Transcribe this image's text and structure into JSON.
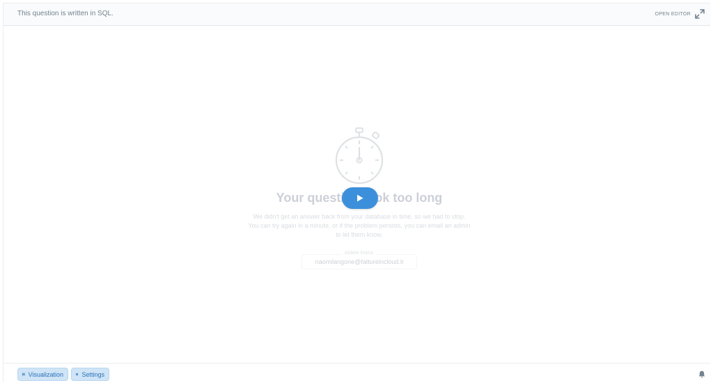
{
  "header": {
    "note": "This question is written in SQL.",
    "open_editor_label": "OPEN EDITOR",
    "open_editor_icon": "expand-icon"
  },
  "error": {
    "icon": "stopwatch-icon",
    "title": "Your question took too long",
    "message": "We didn't get an answer back from your database in time, so we had to stop. You can try again in a minute, or if the problem persists, you can email an admin to let them know.",
    "admin_label": "ADMIN EMAIL",
    "admin_email": "naomilangone@fattureincloud.it"
  },
  "run_button": {
    "icon": "play-icon",
    "color": "#3c90db"
  },
  "footer": {
    "visualization_label": "Visualization",
    "visualization_icon": "grid-icon",
    "settings_label": "Settings",
    "settings_icon": "gear-icon",
    "notification_icon": "bell-icon"
  },
  "colors": {
    "accent": "#3c90db",
    "button_bg": "#cfe4f6",
    "button_text": "#2a72b8",
    "muted_text": "#74838f"
  }
}
